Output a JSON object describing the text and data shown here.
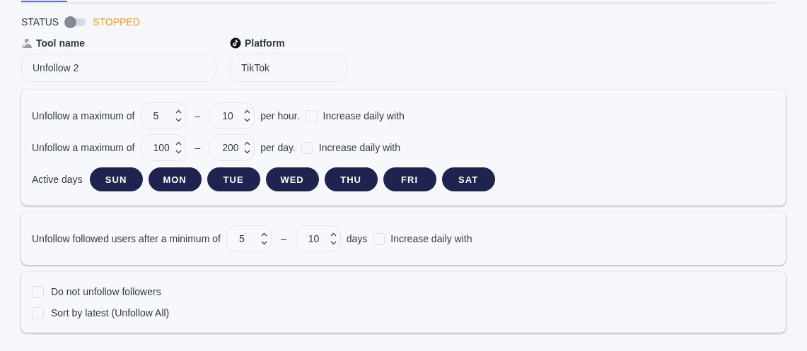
{
  "status": {
    "label": "STATUS",
    "on": false,
    "state_text": "STOPPED"
  },
  "fields": [
    {
      "label": "Tool name",
      "value": "Unfollow 2"
    },
    {
      "label": "Platform",
      "value": "TikTok"
    }
  ],
  "cards": [
    {
      "rows": [
        {
          "kind": "range",
          "prefix": "Unfollow a maximum of",
          "min": "5",
          "separator": "–",
          "max": "10",
          "suffix": "per hour.",
          "checkbox": {
            "label": "Increase daily with",
            "checked": false
          }
        },
        {
          "kind": "range",
          "prefix": "Unfollow a maximum of",
          "min": "100",
          "separator": "–",
          "max": "200",
          "suffix": "per day.",
          "checkbox": {
            "label": "Increase daily with",
            "checked": false
          }
        },
        {
          "kind": "days",
          "label": "Active days",
          "days": [
            {
              "label": "SUN",
              "selected": true
            },
            {
              "label": "MON",
              "selected": true
            },
            {
              "label": "TUE",
              "selected": true
            },
            {
              "label": "WED",
              "selected": true
            },
            {
              "label": "THU",
              "selected": true
            },
            {
              "label": "FRI",
              "selected": true
            },
            {
              "label": "SAT",
              "selected": true
            }
          ]
        }
      ]
    },
    {
      "rows": [
        {
          "kind": "range",
          "prefix": "Unfollow followed users after a minimum of",
          "min": "5",
          "separator": "–",
          "max": "10",
          "suffix": "days",
          "checkbox": {
            "label": "Increase daily with",
            "checked": false
          }
        }
      ]
    },
    {
      "rows": [
        {
          "kind": "check",
          "label": "Do not unfollow followers",
          "checked": false
        },
        {
          "kind": "check",
          "label": "Sort by latest (Unfollow All)",
          "checked": false
        }
      ]
    }
  ]
}
